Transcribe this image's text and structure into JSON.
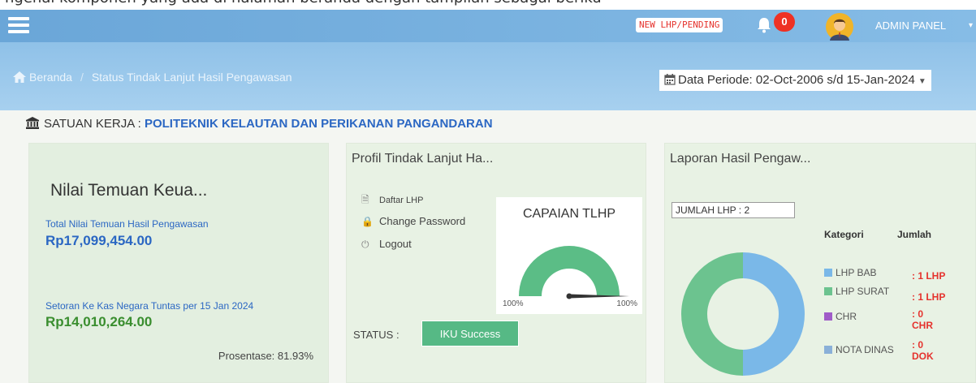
{
  "caption": "ngenai komponen yang ada di halaman beranda dengan tampilan sebagai beriku",
  "topbar": {
    "pending_label": "NEW LHP/PENDING",
    "notification_count": "0",
    "admin_label": "ADMIN PANEL"
  },
  "breadcrumb": {
    "home": "Beranda",
    "current": "Status Tindak Lanjut Hasil Pengawasan"
  },
  "period": {
    "label": "Data Periode: 02-Oct-2006 s/d 15-Jan-2024"
  },
  "satker": {
    "label": "SATUAN KERJA :",
    "value": "POLITEKNIK KELAUTAN DAN PERIKANAN PANGANDARAN"
  },
  "card_keuangan": {
    "title": "Nilai Temuan Keua...",
    "total_label": "Total Nilai Temuan Hasil Pengawasan",
    "total_value": "Rp17,099,454.00",
    "setoran_label": "Setoran Ke Kas Negara Tuntas per 15 Jan 2024",
    "setoran_value": "Rp14,010,264.00",
    "prosentase": "Prosentase: 81.93%"
  },
  "card_profil": {
    "title": "Profil Tindak Lanjut Ha...",
    "menu": [
      {
        "label": "Daftar LHP",
        "icon": "document-icon"
      },
      {
        "label": "Change Password",
        "icon": "lock-icon"
      },
      {
        "label": "Logout",
        "icon": "power-icon"
      }
    ],
    "gauge": {
      "title": "CAPAIAN TLHP",
      "min_label": "100%",
      "max_label": "100%",
      "value_fraction": 1.0,
      "color": "#5bbd86"
    },
    "status_label": "STATUS :",
    "status_button": "IKU Success"
  },
  "card_lhp": {
    "title": "Laporan Hasil Pengaw...",
    "jumlah_label": "JUMLAH LHP : 2",
    "col_kategori": "Kategori",
    "col_jumlah": "Jumlah",
    "legend": [
      {
        "label": "LHP BAB",
        "count": ": 1 LHP",
        "color": "#7ab8e8"
      },
      {
        "label": "LHP SURAT",
        "count": ": 1 LHP",
        "color": "#6cc38f"
      },
      {
        "label": "CHR",
        "count_a": ": 0",
        "count_b": "CHR",
        "color": "#a05cc8"
      },
      {
        "label": "NOTA DINAS",
        "count_a": ": 0",
        "count_b": "DOK",
        "color": "#8ab0d8"
      }
    ]
  },
  "chart_data": {
    "type": "pie",
    "categories": [
      "LHP BAB",
      "LHP SURAT",
      "CHR",
      "NOTA DINAS"
    ],
    "values": [
      1,
      1,
      0,
      0
    ],
    "colors": [
      "#7ab8e8",
      "#6cc38f",
      "#a05cc8",
      "#8ab0d8"
    ]
  }
}
